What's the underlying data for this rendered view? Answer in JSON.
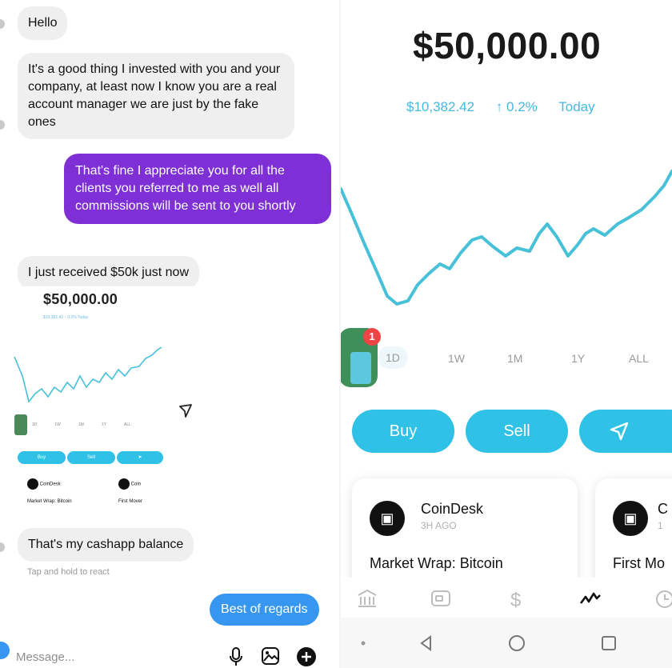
{
  "chat": {
    "messages": [
      {
        "from": "them",
        "text": "Hello"
      },
      {
        "from": "them",
        "text": "It's a good thing I invested with you and your company, at least now I know you are a real account manager we are just by the fake ones"
      },
      {
        "from": "me",
        "text": "That's fine I appreciate you for all the clients you referred to me as well all commissions will be sent to you shortly"
      },
      {
        "from": "them",
        "text": "I just received $50k just now"
      },
      {
        "from": "them",
        "text": "That's my cashapp balance"
      },
      {
        "from": "me",
        "text": "Best of regards"
      }
    ],
    "react_hint": "Tap and hold to react",
    "composer_placeholder": "Message...",
    "mini_screenshot": {
      "balance": "$50,000.00",
      "subline": "$10,382.42  ↑ 0.2%  Today",
      "ranges": [
        "1D",
        "1W",
        "1M",
        "1Y",
        "ALL"
      ],
      "buy": "Buy",
      "sell": "Sell",
      "card1_source": "CoinDesk",
      "card1_headline": "Market Wrap: Bitcoin",
      "card2_source": "Coin",
      "card2_headline": "First Mover"
    },
    "icons": [
      "mic-icon",
      "gallery-icon",
      "plus-icon",
      "send-icon",
      "camera-icon"
    ]
  },
  "app": {
    "balance": "$50,000.00",
    "amount": "$10,382.42",
    "change": "↑ 0.2%",
    "period": "Today",
    "badge_count": "1",
    "ranges": [
      "1D",
      "1W",
      "1M",
      "1Y",
      "ALL"
    ],
    "active_range": "1D",
    "buttons": {
      "buy": "Buy",
      "sell": "Sell"
    },
    "cards": [
      {
        "source": "CoinDesk",
        "age": "3H AGO",
        "headline": "Market Wrap: Bitcoin"
      },
      {
        "source": "C",
        "age": "1",
        "headline": "First Mo"
      }
    ],
    "tab_icons": [
      "bank-icon",
      "card-icon",
      "dollar-icon",
      "investing-icon",
      "clock-icon"
    ],
    "system_nav_icons": [
      "dot-icon",
      "back-icon",
      "home-icon",
      "recents-icon"
    ],
    "colors": {
      "accent": "#2fc1e6",
      "chart": "#47c1d8",
      "purple_bubble": "#7f2fd6",
      "blue_bubble": "#3797f0"
    }
  }
}
